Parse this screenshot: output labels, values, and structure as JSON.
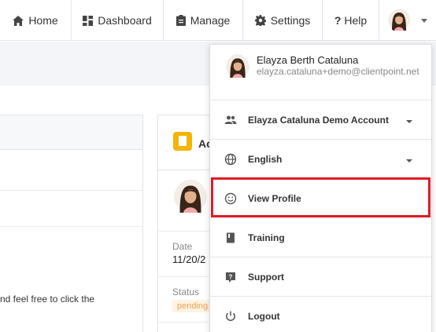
{
  "nav": {
    "home_label": "Home",
    "dashboard_label": "Dashboard",
    "manage_label": "Manage",
    "settings_label": "Settings",
    "help_mark": "?",
    "help_label": "Help",
    "icons": [
      "home-icon",
      "dashboard-icon",
      "clipboard-icon",
      "gear-icon",
      "chevron-down-icon"
    ]
  },
  "background": {
    "left_text": "nd feel free to click the",
    "card_title": "Ac",
    "date_label": "Date",
    "date_value": "11/20/2",
    "status_label": "Status",
    "status_value": "pending"
  },
  "menu": {
    "user_name": "Elayza Berth Cataluna",
    "user_email": "elayza.cataluna+demo@clientpoint.net",
    "items": [
      {
        "label": "Elayza Cataluna Demo Account",
        "icon": "people-icon",
        "has_caret": true
      },
      {
        "label": "English",
        "icon": "globe-icon",
        "has_caret": true
      },
      {
        "label": "View Profile",
        "icon": "smiley-icon",
        "has_caret": false
      },
      {
        "label": "Training",
        "icon": "book-icon",
        "has_caret": false
      },
      {
        "label": "Support",
        "icon": "help-icon",
        "has_caret": false
      },
      {
        "label": "Logout",
        "icon": "power-icon",
        "has_caret": false
      }
    ]
  },
  "colors": {
    "highlight": "#e01b24",
    "accent_doc": "#f4b400",
    "pending_text": "#f0a050"
  }
}
